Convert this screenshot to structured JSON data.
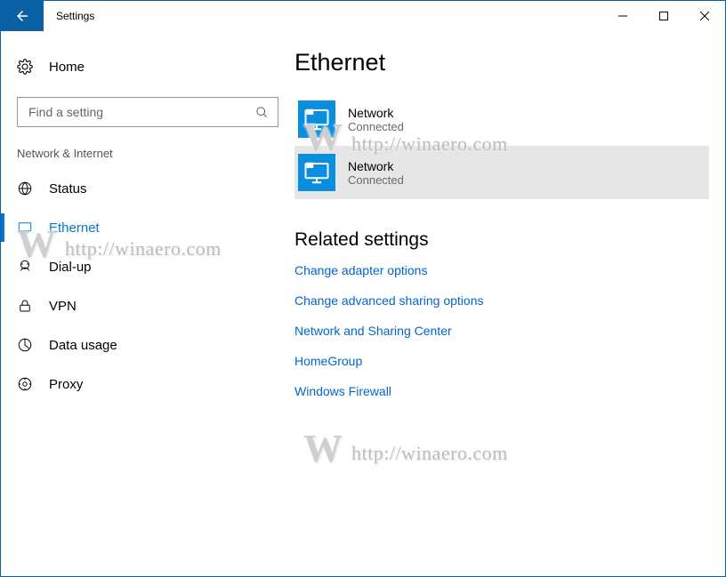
{
  "window": {
    "title": "Settings"
  },
  "sidebar": {
    "home_label": "Home",
    "search_placeholder": "Find a setting",
    "category": "Network & Internet",
    "items": [
      {
        "label": "Status"
      },
      {
        "label": "Ethernet"
      },
      {
        "label": "Dial-up"
      },
      {
        "label": "VPN"
      },
      {
        "label": "Data usage"
      },
      {
        "label": "Proxy"
      }
    ],
    "selected_index": 1
  },
  "page": {
    "title": "Ethernet"
  },
  "adapters": [
    {
      "name": "Network",
      "status": "Connected"
    },
    {
      "name": "Network",
      "status": "Connected"
    }
  ],
  "related": {
    "title": "Related settings",
    "links": [
      "Change adapter options",
      "Change advanced sharing options",
      "Network and Sharing Center",
      "HomeGroup",
      "Windows Firewall"
    ]
  },
  "watermark": {
    "text": "http://winaero.com"
  }
}
